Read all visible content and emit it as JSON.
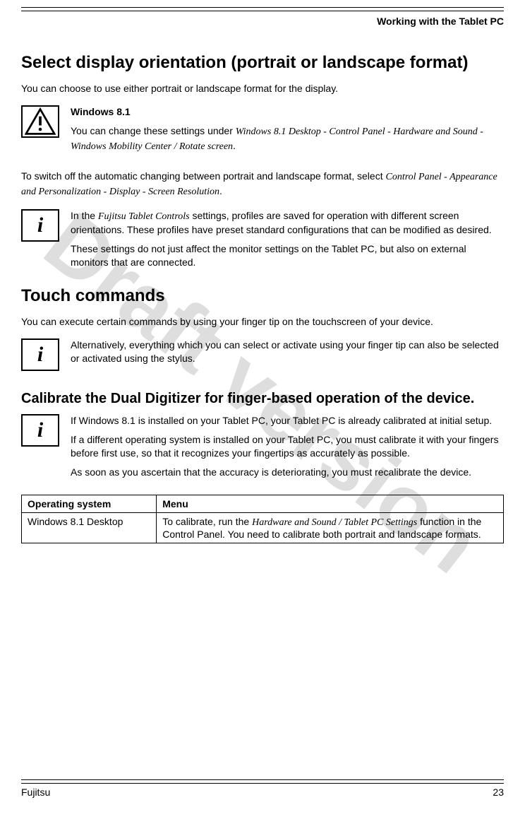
{
  "header": {
    "running_title": "Working with the Tablet PC"
  },
  "watermark": "Draft version",
  "section1": {
    "title": "Select display orientation (portrait or landscape format)",
    "intro": "You can choose to use either portrait or landscape format for the display.",
    "warning": {
      "heading": "Windows 8.1",
      "text_prefix": "You can change these settings under ",
      "text_italic": "Windows 8.1 Desktop - Control Panel - Hardware and Sound - Windows Mobility Center / Rotate screen",
      "text_suffix": "."
    },
    "switch_off_prefix": "To switch off the automatic changing between portrait and landscape format, select ",
    "switch_off_italic": "Control Panel - Appearance and Personalization - Display - Screen Resolution",
    "switch_off_suffix": ".",
    "info1": {
      "p1_prefix": "In the ",
      "p1_italic": "Fujitsu Tablet Controls",
      "p1_suffix": " settings, profiles are saved for operation with different screen orientations. These profiles have preset standard configurations that can be modified as desired.",
      "p2": "These settings do not just affect the monitor settings on the Tablet PC, but also on external monitors that are connected."
    }
  },
  "section2": {
    "title": "Touch commands",
    "intro": "You can execute certain commands by using your finger tip on the touchscreen of your device.",
    "info": {
      "p1": "Alternatively, everything which you can select or activate using your finger tip can also be selected or activated using the stylus."
    }
  },
  "section3": {
    "title": "Calibrate the Dual Digitizer for finger-based operation of the device.",
    "info": {
      "p1": "If Windows 8.1 is installed on your Tablet PC, your Tablet PC is already calibrated at initial setup.",
      "p2": "If a different operating system is installed on your Tablet PC, you must calibrate it with your fingers before first use, so that it recognizes your fingertips as accurately as possible.",
      "p3": "As soon as you ascertain that the accuracy is deteriorating, you must recalibrate the device."
    },
    "table": {
      "header_os": "Operating system",
      "header_menu": "Menu",
      "row1_os": "Windows 8.1 Desktop",
      "row1_menu_prefix": "To calibrate, run the ",
      "row1_menu_italic": "Hardware and Sound / Tablet PC Settings",
      "row1_menu_suffix": " function in the Control Panel. You need to calibrate both portrait and landscape formats."
    }
  },
  "footer": {
    "brand": "Fujitsu",
    "page_number": "23"
  }
}
